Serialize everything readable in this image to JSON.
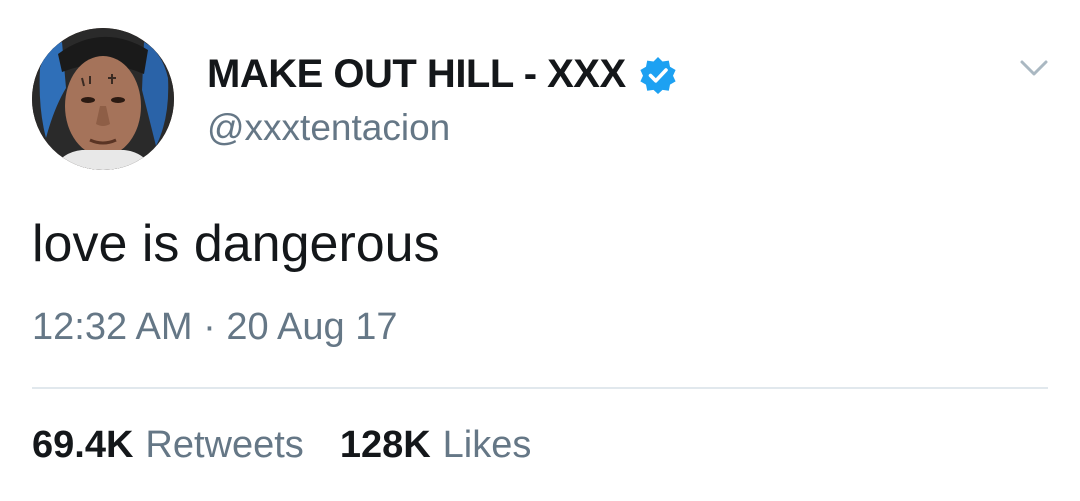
{
  "tweet": {
    "display_name": "MAKE OUT HILL - XXX",
    "handle": "@xxxtentacion",
    "verified": true,
    "text": "love is dangerous",
    "timestamp": "12:32 AM · 20 Aug 17"
  },
  "stats": {
    "retweets_count": "69.4K",
    "retweets_label": "Retweets",
    "likes_count": "128K",
    "likes_label": "Likes"
  },
  "icons": {
    "verified": "verified-badge-icon",
    "more": "chevron-down-icon"
  },
  "colors": {
    "text_primary": "#14171a",
    "text_secondary": "#657786",
    "verified_blue": "#1da1f2",
    "divider": "#e1e8ed"
  }
}
